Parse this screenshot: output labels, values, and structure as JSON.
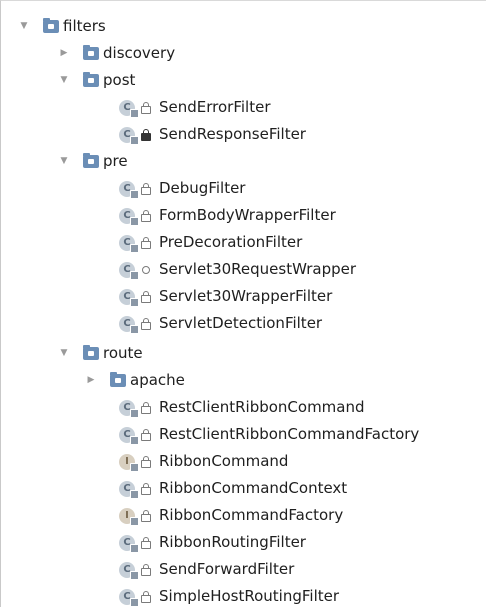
{
  "tree": {
    "root": {
      "label": "filters",
      "expanded": true
    },
    "discovery": {
      "label": "discovery",
      "expanded": false
    },
    "post": {
      "label": "post",
      "expanded": true,
      "items": [
        {
          "label": "SendErrorFilter",
          "kind": "class",
          "modifier": "lock"
        },
        {
          "label": "SendResponseFilter",
          "kind": "class",
          "modifier": "lock-dark"
        }
      ]
    },
    "pre": {
      "label": "pre",
      "expanded": true,
      "items": [
        {
          "label": "DebugFilter",
          "kind": "class",
          "modifier": "lock"
        },
        {
          "label": "FormBodyWrapperFilter",
          "kind": "class",
          "modifier": "lock"
        },
        {
          "label": "PreDecorationFilter",
          "kind": "class",
          "modifier": "lock"
        },
        {
          "label": "Servlet30RequestWrapper",
          "kind": "class",
          "modifier": "dot"
        },
        {
          "label": "Servlet30WrapperFilter",
          "kind": "class",
          "modifier": "lock"
        },
        {
          "label": "ServletDetectionFilter",
          "kind": "class",
          "modifier": "lock"
        }
      ]
    },
    "route": {
      "label": "route",
      "expanded": true,
      "apache": {
        "label": "apache",
        "expanded": false
      },
      "items": [
        {
          "label": "RestClientRibbonCommand",
          "kind": "class",
          "modifier": "lock"
        },
        {
          "label": "RestClientRibbonCommandFactory",
          "kind": "class",
          "modifier": "lock"
        },
        {
          "label": "RibbonCommand",
          "kind": "interface",
          "modifier": "lock"
        },
        {
          "label": "RibbonCommandContext",
          "kind": "class",
          "modifier": "lock"
        },
        {
          "label": "RibbonCommandFactory",
          "kind": "interface",
          "modifier": "lock"
        },
        {
          "label": "RibbonRoutingFilter",
          "kind": "class",
          "modifier": "lock"
        },
        {
          "label": "SendForwardFilter",
          "kind": "class",
          "modifier": "lock"
        },
        {
          "label": "SimpleHostRoutingFilter",
          "kind": "class",
          "modifier": "lock"
        }
      ]
    }
  },
  "icons": {
    "expanded": "▼",
    "collapsed": "▶",
    "class_letter": "C",
    "interface_letter": "I"
  }
}
